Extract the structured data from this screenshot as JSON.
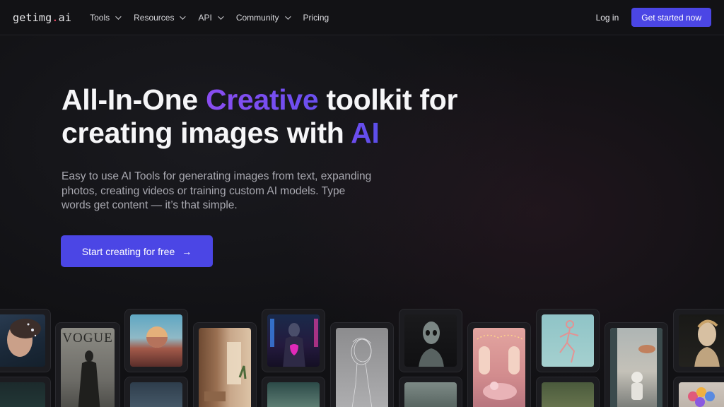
{
  "nav": {
    "logo_text": "getimg",
    "logo_dot": ".",
    "logo_suffix": "ai",
    "links": [
      {
        "label": "Tools",
        "has_dropdown": true
      },
      {
        "label": "Resources",
        "has_dropdown": true
      },
      {
        "label": "API",
        "has_dropdown": true
      },
      {
        "label": "Community",
        "has_dropdown": true
      },
      {
        "label": "Pricing",
        "has_dropdown": false
      }
    ],
    "login_label": "Log in",
    "cta_label": "Get started now"
  },
  "hero": {
    "headline_part1": "All-In-One ",
    "headline_accent1": "Creative",
    "headline_part2": " toolkit for creating images with ",
    "headline_accent2": "AI",
    "subtitle": "Easy to use AI Tools for generating images from text, expanding photos, creating videos or training custom AI models. Type words get content — it’s that simple.",
    "cta_label": "Start creating for free",
    "cta_icon": "arrow-right-icon"
  },
  "gallery": {
    "items": [
      {
        "name": "gallery-face-portrait",
        "caption": ""
      },
      {
        "name": "gallery-vogue-cover",
        "caption": "VOGUE"
      },
      {
        "name": "gallery-sphere-landscape",
        "caption": ""
      },
      {
        "name": "gallery-interior-room",
        "caption": ""
      },
      {
        "name": "gallery-neon-cyborg",
        "caption": ""
      },
      {
        "name": "gallery-sketch-figure",
        "caption": ""
      },
      {
        "name": "gallery-alien-bust",
        "caption": ""
      },
      {
        "name": "gallery-pink-room",
        "caption": ""
      },
      {
        "name": "gallery-glass-runner",
        "caption": ""
      },
      {
        "name": "gallery-astronaut-portrait",
        "caption": ""
      },
      {
        "name": "gallery-android-bust",
        "caption": ""
      }
    ]
  },
  "colors": {
    "background": "#111114",
    "accent": "#4b46e5",
    "accent_purple": "#8a4df0",
    "logo_dot": "#ff4f6e"
  }
}
